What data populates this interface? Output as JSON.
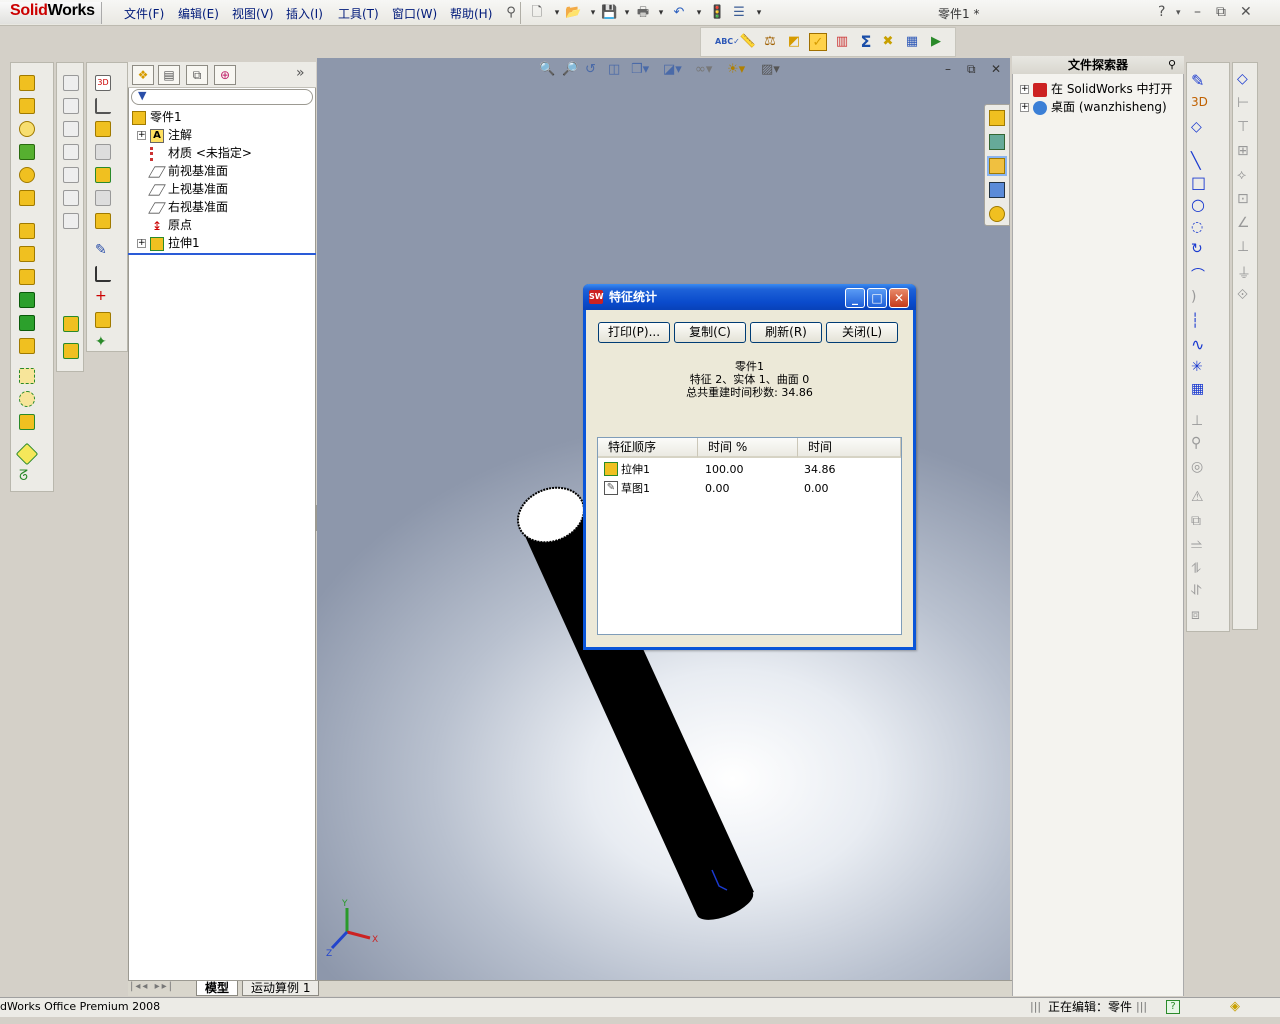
{
  "app": {
    "logo_prefix": "Solid",
    "logo_suffix": "Works",
    "doc_title": "零件1 *"
  },
  "menu": [
    "文件(F)",
    "编辑(E)",
    "视图(V)",
    "插入(I)",
    "工具(T)",
    "窗口(W)",
    "帮助(H)"
  ],
  "window_controls": {
    "help": "?",
    "minimize": "–",
    "restore": "⧉",
    "close": "✕"
  },
  "feature_manager": {
    "tabs": [
      "feature-manager-tab",
      "property-manager-tab",
      "configuration-manager-tab",
      "dimxpert-tab"
    ],
    "expand_symbol": "»",
    "tree": [
      {
        "label": "零件1",
        "icon": "part-icon",
        "expander": ""
      },
      {
        "label": "注解",
        "icon": "annotation-icon",
        "expander": "+"
      },
      {
        "label": "材质 <未指定>",
        "icon": "material-icon",
        "expander": ""
      },
      {
        "label": "前视基准面",
        "icon": "plane-icon",
        "expander": ""
      },
      {
        "label": "上视基准面",
        "icon": "plane-icon",
        "expander": ""
      },
      {
        "label": "右视基准面",
        "icon": "plane-icon",
        "expander": ""
      },
      {
        "label": "原点",
        "icon": "origin-icon",
        "expander": ""
      },
      {
        "label": "拉伸1",
        "icon": "extrude-icon",
        "expander": "+"
      }
    ]
  },
  "task_pane": {
    "title": "文件探索器",
    "items": [
      {
        "label": "在 SolidWorks 中打开",
        "expander": "+"
      },
      {
        "label": "桌面 (wanzhisheng)",
        "expander": "+"
      }
    ]
  },
  "dialog": {
    "title": "特征统计",
    "buttons": {
      "print": "打印(P)...",
      "copy": "复制(C)",
      "refresh": "刷新(R)",
      "close": "关闭(L)"
    },
    "info": {
      "part": "零件1",
      "counts": "特征 2、实体 1、曲面 0",
      "rebuild": "总共重建时间秒数: 34.86"
    },
    "table": {
      "headers": [
        "特征顺序",
        "时间 %",
        "时间"
      ],
      "rows": [
        {
          "name": "拉伸1",
          "percent": "100.00",
          "time": "34.86"
        },
        {
          "name": "草图1",
          "percent": "0.00",
          "time": "0.00"
        }
      ]
    }
  },
  "bottom_tabs": [
    "模型",
    "运动算例 1"
  ],
  "status": {
    "product": "dWorks Office Premium 2008",
    "editing": "正在编辑：零件"
  },
  "triad": {
    "x": "X",
    "y": "Y",
    "z": "Z"
  },
  "colors": {
    "accent_blue": "#0a55d8",
    "model_black": "#000000",
    "logo_red": "#cc0000"
  }
}
